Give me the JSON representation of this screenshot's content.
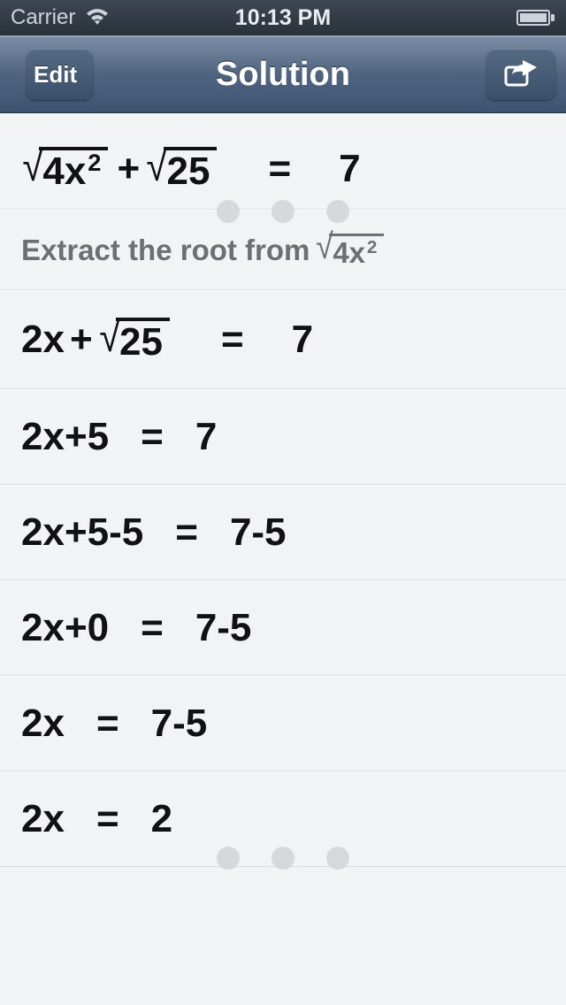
{
  "statusbar": {
    "carrier": "Carrier",
    "time": "10:13 PM"
  },
  "nav": {
    "back_label": "Edit",
    "title": "Solution"
  },
  "problem": {
    "lhs_sqrt1_base": "4x",
    "lhs_sqrt1_exp": "2",
    "op1": "+",
    "lhs_sqrt2": "25",
    "eq": "=",
    "rhs": "7"
  },
  "hint": {
    "prefix": "Extract the root from",
    "expr_base": "4x",
    "expr_exp": "2"
  },
  "steps": [
    {
      "lhs_a": "2x",
      "op": "+",
      "lhs_sqrt": "25",
      "eq": "=",
      "rhs": "7"
    },
    {
      "lhs": "2x+5",
      "eq": "=",
      "rhs": "7"
    },
    {
      "lhs": "2x+5-5",
      "eq": "=",
      "rhs": "7-5"
    },
    {
      "lhs": "2x+0",
      "eq": "=",
      "rhs": "7-5"
    },
    {
      "lhs": "2x",
      "eq": "=",
      "rhs": "7-5"
    },
    {
      "lhs": "2x",
      "eq": "=",
      "rhs": "2"
    }
  ]
}
